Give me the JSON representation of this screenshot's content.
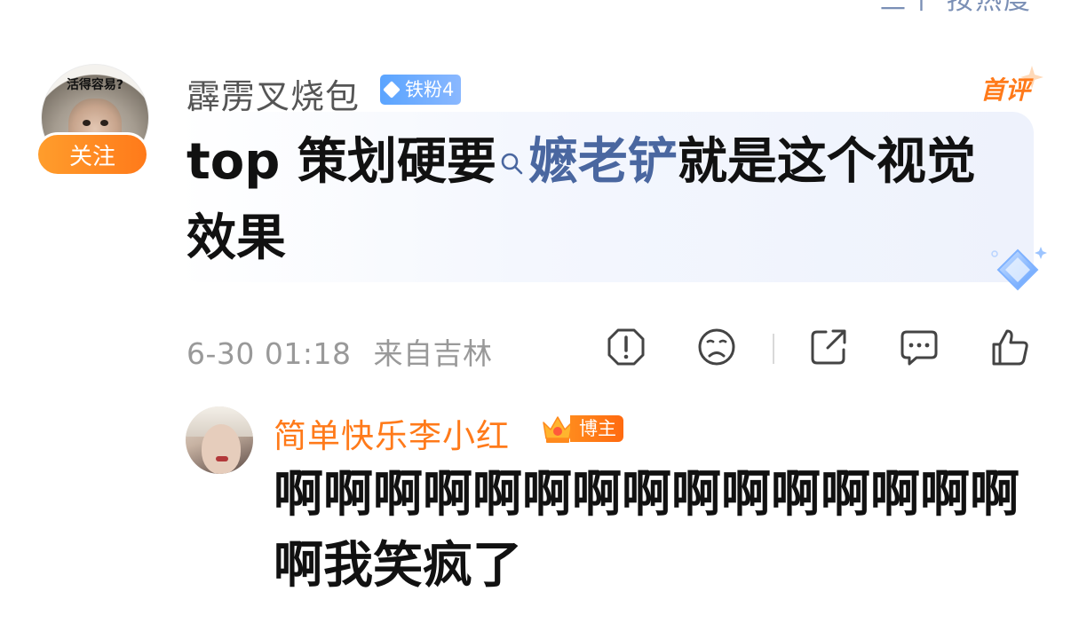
{
  "top_crop_text": "三个 按热度",
  "main_comment": {
    "avatar_caption": "活得容易?",
    "follow_label": "关注",
    "username": "霹雳叉烧包",
    "fan_badge": "铁粉4",
    "first_comment_label": "首评",
    "text_prefix": "top 策划硬要",
    "search_term": "嬷老铲",
    "text_suffix": "就是这个视觉效果",
    "timestamp": "6-30 01:18",
    "location": "来自吉林"
  },
  "actions": [
    {
      "name": "report",
      "icon": "warning-icon"
    },
    {
      "name": "dislike",
      "icon": "sad-face-icon"
    },
    {
      "name": "share",
      "icon": "share-icon"
    },
    {
      "name": "comment",
      "icon": "comment-icon"
    },
    {
      "name": "like",
      "icon": "thumbs-up-icon"
    }
  ],
  "reply": {
    "username": "简单快乐李小红",
    "badge_label": "博主",
    "text": "啊啊啊啊啊啊啊啊啊啊啊啊啊啊啊啊我笑疯了"
  },
  "colors": {
    "accent_orange": "#ff7a1a",
    "link_blue": "#4a67a0",
    "meta_gray": "#999999"
  }
}
